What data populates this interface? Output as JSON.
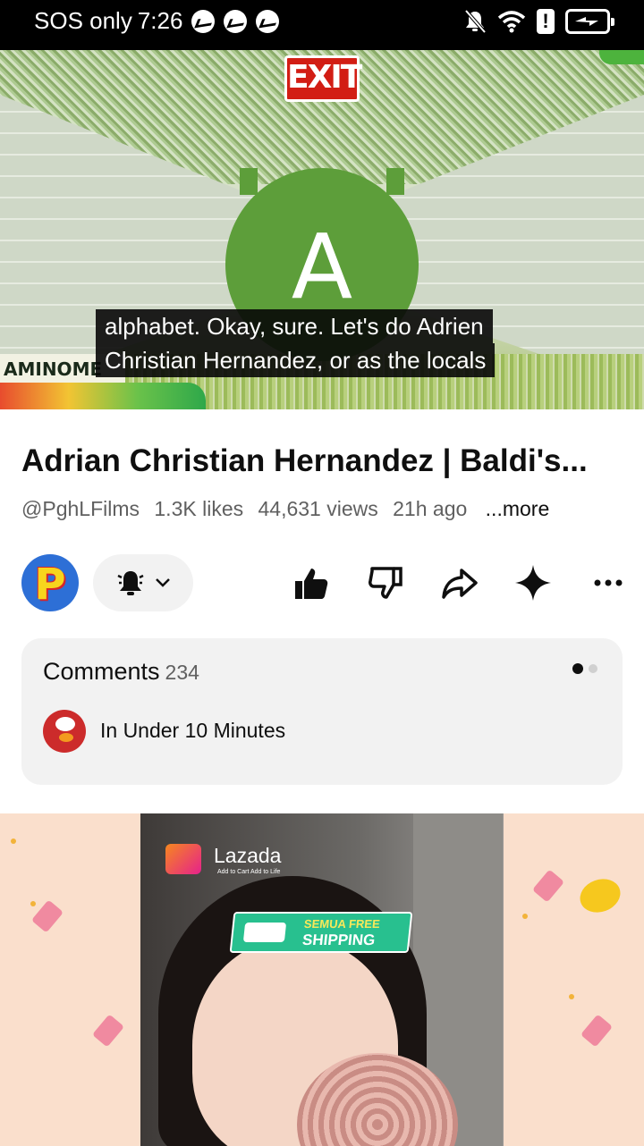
{
  "status_bar": {
    "left_text": "SOS only",
    "time": "7:26",
    "notification_icons": [
      "messenger-icon",
      "messenger-icon",
      "messenger-icon"
    ],
    "right_icons": [
      "bell-off-icon",
      "wifi-icon",
      "alert-icon",
      "battery-charging-icon"
    ],
    "alert_glyph": "!"
  },
  "video": {
    "sign_text": "EXIT",
    "letter": "A",
    "wall_sign": "AMINOME",
    "caption_lines": [
      "alphabet. Okay, sure. Let's do Adrien",
      "Christian Hernandez, or as the locals"
    ]
  },
  "details": {
    "title": "Adrian Christian Hernandez | Baldi's...",
    "channel": "@PghLFilms",
    "likes": "1.3K likes",
    "views": "44,631 views",
    "age": "21h ago",
    "more_label": "...more"
  },
  "actions": {
    "channel_avatar_letter": "P",
    "icons": [
      "subscribe-bell-icon",
      "like-icon",
      "dislike-icon",
      "share-icon",
      "ask-ai-icon",
      "more-options-icon"
    ]
  },
  "comments": {
    "label": "Comments",
    "count": "234",
    "teaser": "In Under 10 Minutes"
  },
  "ad": {
    "brand": "Lazada",
    "tagline": "Add to Cart Add to Life",
    "badge_line1": "SEMUA FREE",
    "badge_line2": "SHIPPING"
  },
  "colors": {
    "status_bar_bg": "#000000",
    "sheet_bg": "#ffffff",
    "comments_bg": "#f2f2f2",
    "text_primary": "#0f0f0f",
    "text_secondary": "#606060",
    "ad_bg": "#fadfcc"
  }
}
